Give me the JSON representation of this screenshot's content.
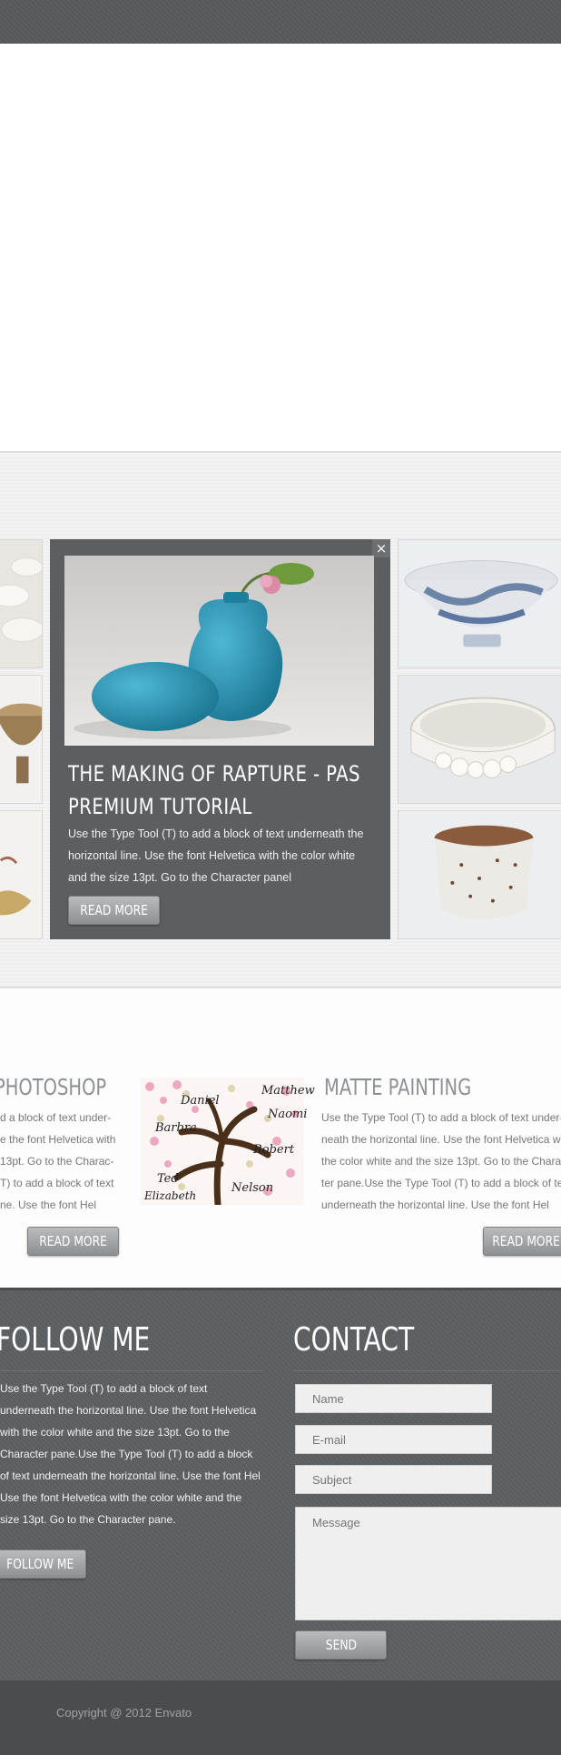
{
  "feature": {
    "close_glyph": "×",
    "title": "THE MAKING OF RAPTURE - PAS PREMIUM TUTORIAL",
    "text": "Use the Type Tool (T) to add a block of text underneath the horizontal line. Use the font Helvetica with the color white and the size 13pt. Go to the Character panel",
    "button": "READ MORE"
  },
  "posts": [
    {
      "title": "PHOTOSHOP",
      "lines": [
        "d a block of text under-",
        "e the font Helvetica with",
        "13pt. Go to the Charac-",
        "T) to add a block of text",
        "ne. Use the font Hel"
      ],
      "button": "READ MORE"
    },
    {
      "title": "MATTE PAINTING",
      "lines": [
        "Use the Type Tool (T) to add a block of text under-",
        "neath the horizontal line. Use the font Helvetica with",
        "the color white and the size 13pt. Go to the Charac-",
        "ter pane.Use the Type Tool (T) to add a block of text",
        "underneath the horizontal line. Use the font Hel"
      ],
      "button": "READ MORE"
    }
  ],
  "painting": {
    "names": [
      "Daniel",
      "Matthew",
      "Naomi",
      "Barbra",
      "Robert",
      "Ted",
      "Nelson",
      "Elizabeth"
    ]
  },
  "footer": {
    "follow_title": "FOLLOW ME",
    "follow_text": "Use the Type Tool (T) to add a block of text underneath the horizontal line. Use the font Helvetica with the color white and the size 13pt. Go to the Character pane.Use the Type Tool (T) to add a block of text underneath the horizontal line. Use the font Hel Use the font Helvetica with the color white and the size 13pt. Go to the Character pane.",
    "follow_button": "FOLLOW ME",
    "contact_title": "CONTACT",
    "name_placeholder": "Name",
    "email_placeholder": "E-mail",
    "subject_placeholder": "Subject",
    "message_placeholder": "Message",
    "send_button": "SEND"
  },
  "copyright": "Copyright @ 2012 Envato",
  "colors": {
    "dark_gray": "#5c5f62",
    "button_gray": "#8d9093",
    "title_gray": "#8d9196",
    "accent_teal": "#2f8fae"
  }
}
